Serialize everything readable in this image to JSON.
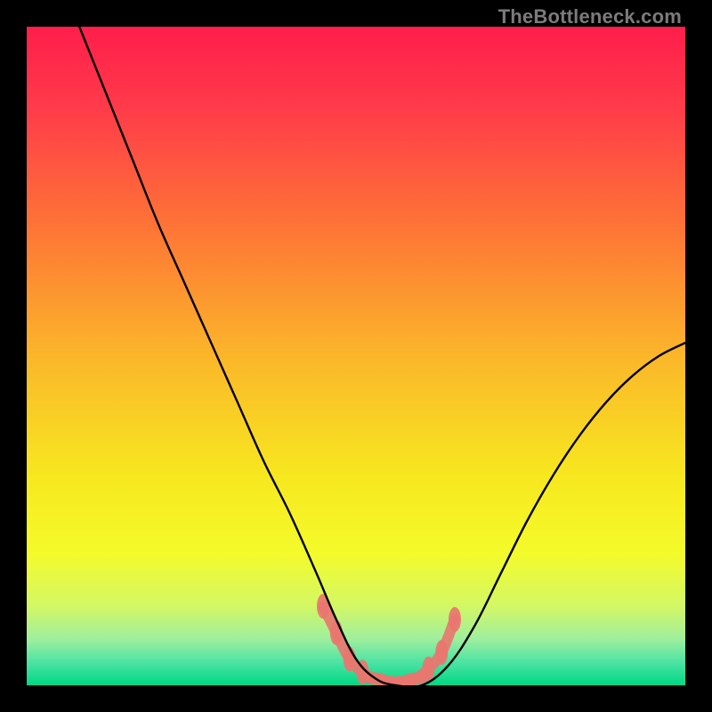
{
  "watermark": "TheBottleneck.com",
  "chart_data": {
    "type": "line",
    "title": "",
    "xlabel": "",
    "ylabel": "",
    "xlim": [
      0,
      100
    ],
    "ylim": [
      0,
      100
    ],
    "grid": false,
    "legend": false,
    "background_gradient": {
      "stops": [
        {
          "pos": 0.0,
          "color": "#ff1e4b"
        },
        {
          "pos": 0.12,
          "color": "#ff3a4a"
        },
        {
          "pos": 0.3,
          "color": "#fe7336"
        },
        {
          "pos": 0.5,
          "color": "#fbb62a"
        },
        {
          "pos": 0.68,
          "color": "#f7e71f"
        },
        {
          "pos": 0.8,
          "color": "#f4fb2a"
        },
        {
          "pos": 0.88,
          "color": "#d3f766"
        },
        {
          "pos": 0.93,
          "color": "#9eef9e"
        },
        {
          "pos": 0.965,
          "color": "#4de3a4"
        },
        {
          "pos": 1.0,
          "color": "#00d884"
        }
      ]
    },
    "series": [
      {
        "name": "bottleneck-curve",
        "color": "#000000",
        "x": [
          8,
          12,
          16,
          20,
          24,
          28,
          32,
          36,
          40,
          44,
          47,
          50,
          53,
          56,
          60,
          64,
          68,
          72,
          76,
          80,
          84,
          88,
          92,
          96,
          100
        ],
        "y": [
          100,
          90,
          80,
          70,
          61,
          52,
          43,
          34,
          26,
          17,
          10,
          4,
          1,
          0,
          0,
          3,
          9,
          17,
          25,
          32,
          38,
          43,
          47,
          50,
          52
        ]
      }
    ],
    "annotations": [
      {
        "name": "trough-marker",
        "type": "scatter-band",
        "color": "#e9766f",
        "points": [
          {
            "x": 45,
            "y": 12
          },
          {
            "x": 47,
            "y": 8
          },
          {
            "x": 49,
            "y": 4
          },
          {
            "x": 51,
            "y": 2
          },
          {
            "x": 53,
            "y": 1
          },
          {
            "x": 55,
            "y": 0.5
          },
          {
            "x": 57,
            "y": 0.5
          },
          {
            "x": 59,
            "y": 1
          },
          {
            "x": 61,
            "y": 2.5
          },
          {
            "x": 63,
            "y": 5
          },
          {
            "x": 65,
            "y": 10
          }
        ]
      }
    ]
  }
}
